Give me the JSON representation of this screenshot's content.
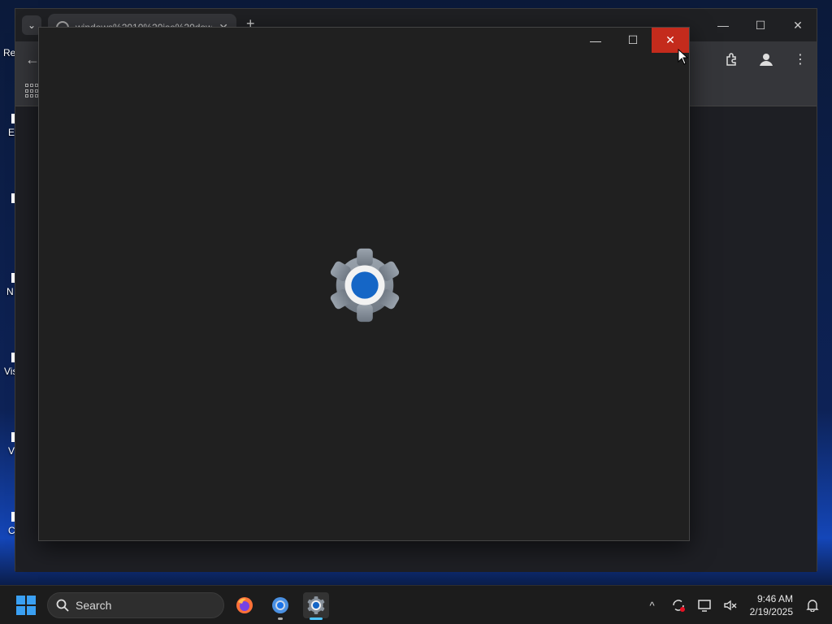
{
  "desktop": {
    "icon_labels": [
      "Re",
      "E",
      "N",
      "Vis",
      "V",
      "C"
    ]
  },
  "browser": {
    "tab_title": "windows%2010%20iso%20dow",
    "new_tab_label": "+",
    "tab_close_label": "✕",
    "window_controls": [
      "—",
      "☐",
      "✕"
    ]
  },
  "settings_window": {
    "controls": [
      "—",
      "☐",
      "✕"
    ],
    "icon": "settings-gear-icon"
  },
  "taskbar": {
    "search_placeholder": "Search",
    "apps": [
      "firefox-icon",
      "chrome-icon",
      "settings-icon"
    ],
    "tray": {
      "overflow": "^",
      "time": "9:46 AM",
      "date": "2/19/2025"
    }
  },
  "colors": {
    "close_red": "#c42b1c",
    "accent_blue": "#4cc2ff",
    "gear_center": "#1566c6"
  }
}
